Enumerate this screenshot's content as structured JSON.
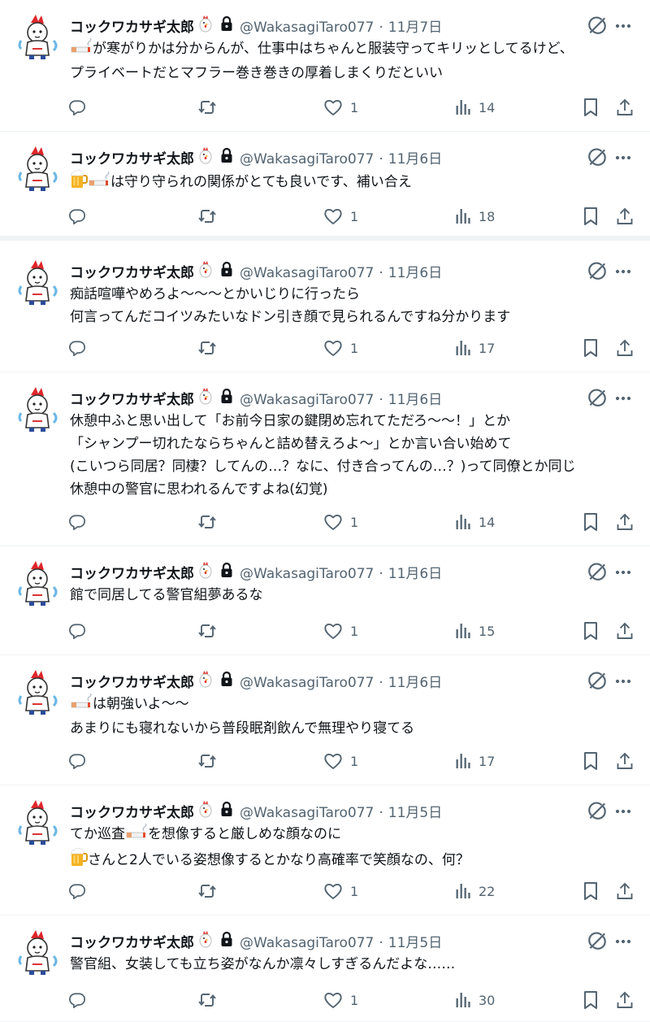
{
  "author": {
    "name": "コックワカサギ太郎",
    "handle": "@WakasagiTaro077",
    "name_emoji": "rooster-icon",
    "protected_icon": "lock-icon",
    "avatar": "chef-avatar"
  },
  "separator": "·",
  "icons": {
    "reply": "reply-icon",
    "retweet": "retweet-icon",
    "like": "heart-icon",
    "views": "views-icon",
    "bookmark": "bookmark-icon",
    "share": "share-icon",
    "grok": "grok-icon",
    "more": "more-icon"
  },
  "posts": [
    {
      "date": "11月7日",
      "lines": [
        {
          "pre": "🚬",
          "text": "が寒がりかは分からんが、仕事中はちゃんと服装守ってキリッとしてるけど、"
        },
        {
          "text": "プライベートだとマフラー巻き巻きの厚着しまくりだといい"
        }
      ],
      "likes": "1",
      "views": "14"
    },
    {
      "date": "11月6日",
      "lines": [
        {
          "pre": "🍺🚬",
          "text": "は守り守られの関係がとても良いです、補い合え"
        }
      ],
      "likes": "1",
      "views": "18"
    },
    {
      "date": "11月6日",
      "lines": [
        {
          "text": "痴話喧嘩やめろよ〜〜〜とかいじりに行ったら"
        },
        {
          "text": "何言ってんだコイツみたいなドン引き顔で見られるんですね分かります"
        }
      ],
      "likes": "1",
      "views": "17"
    },
    {
      "date": "11月6日",
      "lines": [
        {
          "text": "休憩中ふと思い出して「お前今日家の鍵閉め忘れてただろ〜〜！」とか"
        },
        {
          "text": "「シャンプー切れたならちゃんと詰め替えろよ〜」とか言い合い始めて"
        },
        {
          "text": "(こいつら同居？同棲？してんの…？なに、付き合ってんの…？)って同僚とか同じ"
        },
        {
          "text": "休憩中の警官に思われるんですよね(幻覚)"
        }
      ],
      "likes": "1",
      "views": "14"
    },
    {
      "date": "11月6日",
      "lines": [
        {
          "text": "館で同居してる警官組夢あるな"
        }
      ],
      "likes": "1",
      "views": "15"
    },
    {
      "date": "11月6日",
      "lines": [
        {
          "pre": "🚬",
          "text": "は朝強いよ〜〜"
        },
        {
          "text": "あまりにも寝れないから普段眠剤飲んで無理やり寝てる"
        }
      ],
      "likes": "1",
      "views": "17"
    },
    {
      "date": "11月5日",
      "lines": [
        {
          "text": "てか巡査",
          "mid": "🚬",
          "post": "を想像すると厳しめな顔なのに"
        },
        {
          "pre": "🍺",
          "text": "さんと2人でいる姿想像するとかなり高確率で笑顔なの、何？"
        }
      ],
      "likes": "1",
      "views": "22"
    },
    {
      "date": "11月5日",
      "lines": [
        {
          "text": "警官組、女装しても立ち姿がなんか凛々しすぎるんだよな……"
        }
      ],
      "likes": "1",
      "views": "30"
    }
  ]
}
